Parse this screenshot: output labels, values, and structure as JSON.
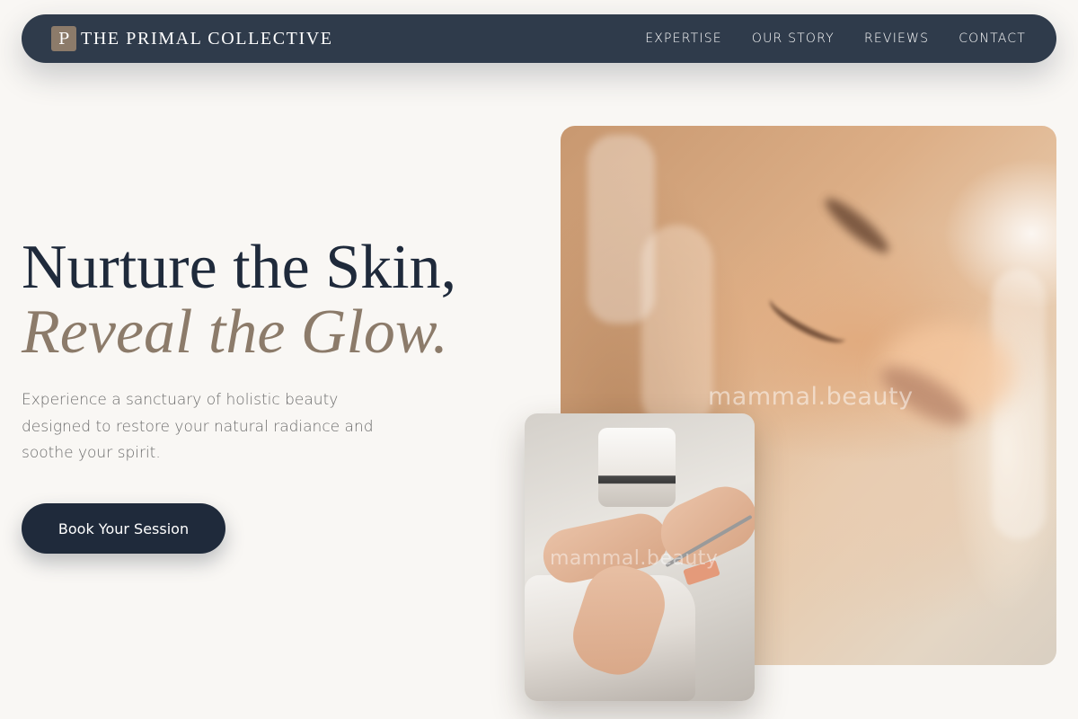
{
  "brand": {
    "mark": "P",
    "name": "THE PRIMAL COLLECTIVE"
  },
  "nav": {
    "items": [
      {
        "label": "EXPERTISE"
      },
      {
        "label": "OUR STORY"
      },
      {
        "label": "REVIEWS"
      },
      {
        "label": "CONTACT"
      }
    ]
  },
  "hero": {
    "line1": "Nurture the Skin,",
    "line2": "Reveal the Glow.",
    "description": "Experience a sanctuary of holistic beauty designed to restore your natural radiance and soothe your spirit.",
    "cta_label": "Book Your Session"
  },
  "images": {
    "main_watermark": "mammal.beauty",
    "secondary_watermark": "mammal.beauty"
  },
  "colors": {
    "navbar": "#2f3b4b",
    "heading": "#1f2a3b",
    "accent": "#8c7b6a",
    "background": "#f9f7f4",
    "cta": "#1f2a3b"
  }
}
